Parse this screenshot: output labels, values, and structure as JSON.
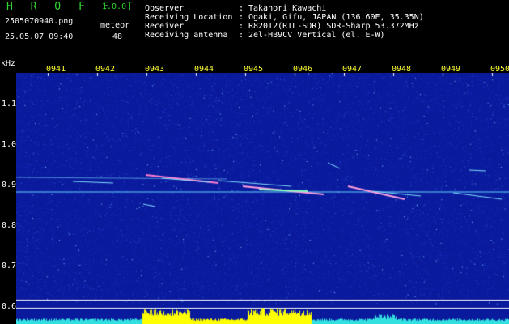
{
  "app": {
    "title": "H R O F F T",
    "version": "1.0.0"
  },
  "file": {
    "name": "2505070940.png",
    "datetime": "25.05.07 09:40"
  },
  "meteor": {
    "label": "meteor",
    "count": "48"
  },
  "header": [
    {
      "label": "Observer",
      "sep": ":",
      "value": "Takanori Kawachi"
    },
    {
      "label": "Receiving Location",
      "sep": ":",
      "value": "Ogaki, Gifu, JAPAN (136.60E, 35.35N)"
    },
    {
      "label": "Receiver",
      "sep": ":",
      "value": "R820T2(RTL-SDR) SDR-Sharp 53.372MHz"
    },
    {
      "label": "Receiving antenna",
      "sep": ":",
      "value": "2el-HB9CV Vertical (el. E-W)"
    }
  ],
  "axis": {
    "y_unit": "kHz",
    "y_ticks": [
      "1.1",
      "1.0",
      "0.9",
      "0.8",
      "0.7",
      "0.6"
    ],
    "x_ticks": [
      "0941",
      "0942",
      "0943",
      "0944",
      "0945",
      "0946",
      "0947",
      "0948",
      "0949",
      "0950"
    ]
  },
  "colors": {
    "background": "#0a1a9c",
    "title": "#2fd82f",
    "ticks": "#ffff33",
    "echo": "#7fe0ff",
    "level": "#ffff00"
  }
}
